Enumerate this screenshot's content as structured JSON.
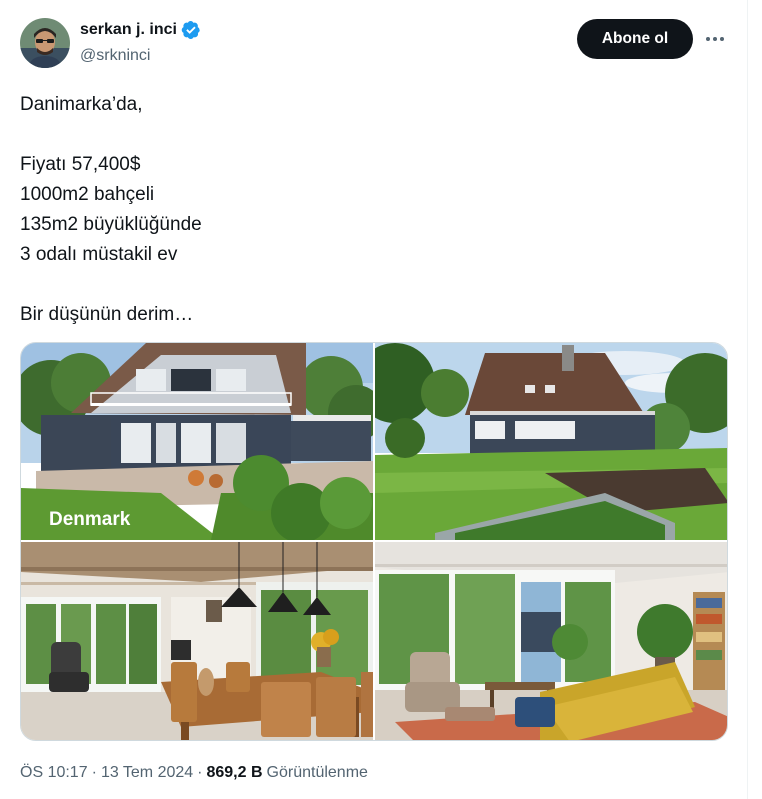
{
  "author": {
    "display_name": "serkan j. inci",
    "handle": "@srkninci",
    "verified_icon": "verified-badge-icon",
    "verified_color": "#1d9bf0"
  },
  "follow_button": {
    "label": "Abone ol"
  },
  "more_menu": {
    "icon": "more-horizontal-icon"
  },
  "tweet": {
    "lines": [
      "Danimarka’da,",
      "",
      "Fiyatı 57,400$",
      "1000m2 bahçeli",
      "135m2 büyüklüğünde",
      "3 odalı müstakil ev",
      "",
      "Bir düşünün derim…"
    ]
  },
  "media": {
    "photos": [
      {
        "subject": "house-exterior-front-photo",
        "watermark": "Denmark"
      },
      {
        "subject": "house-exterior-garden-photo"
      },
      {
        "subject": "dining-room-interior-photo"
      },
      {
        "subject": "living-room-interior-photo"
      }
    ]
  },
  "meta": {
    "time": "ÖS 10:17",
    "separator": "·",
    "date": "13 Tem 2024",
    "views_count": "869,2 B",
    "views_label": "Görüntülenme"
  },
  "colors": {
    "text_primary": "#0f1419",
    "text_secondary": "#536471",
    "follow_button_bg": "#0f1419",
    "border": "#cfd9de"
  }
}
